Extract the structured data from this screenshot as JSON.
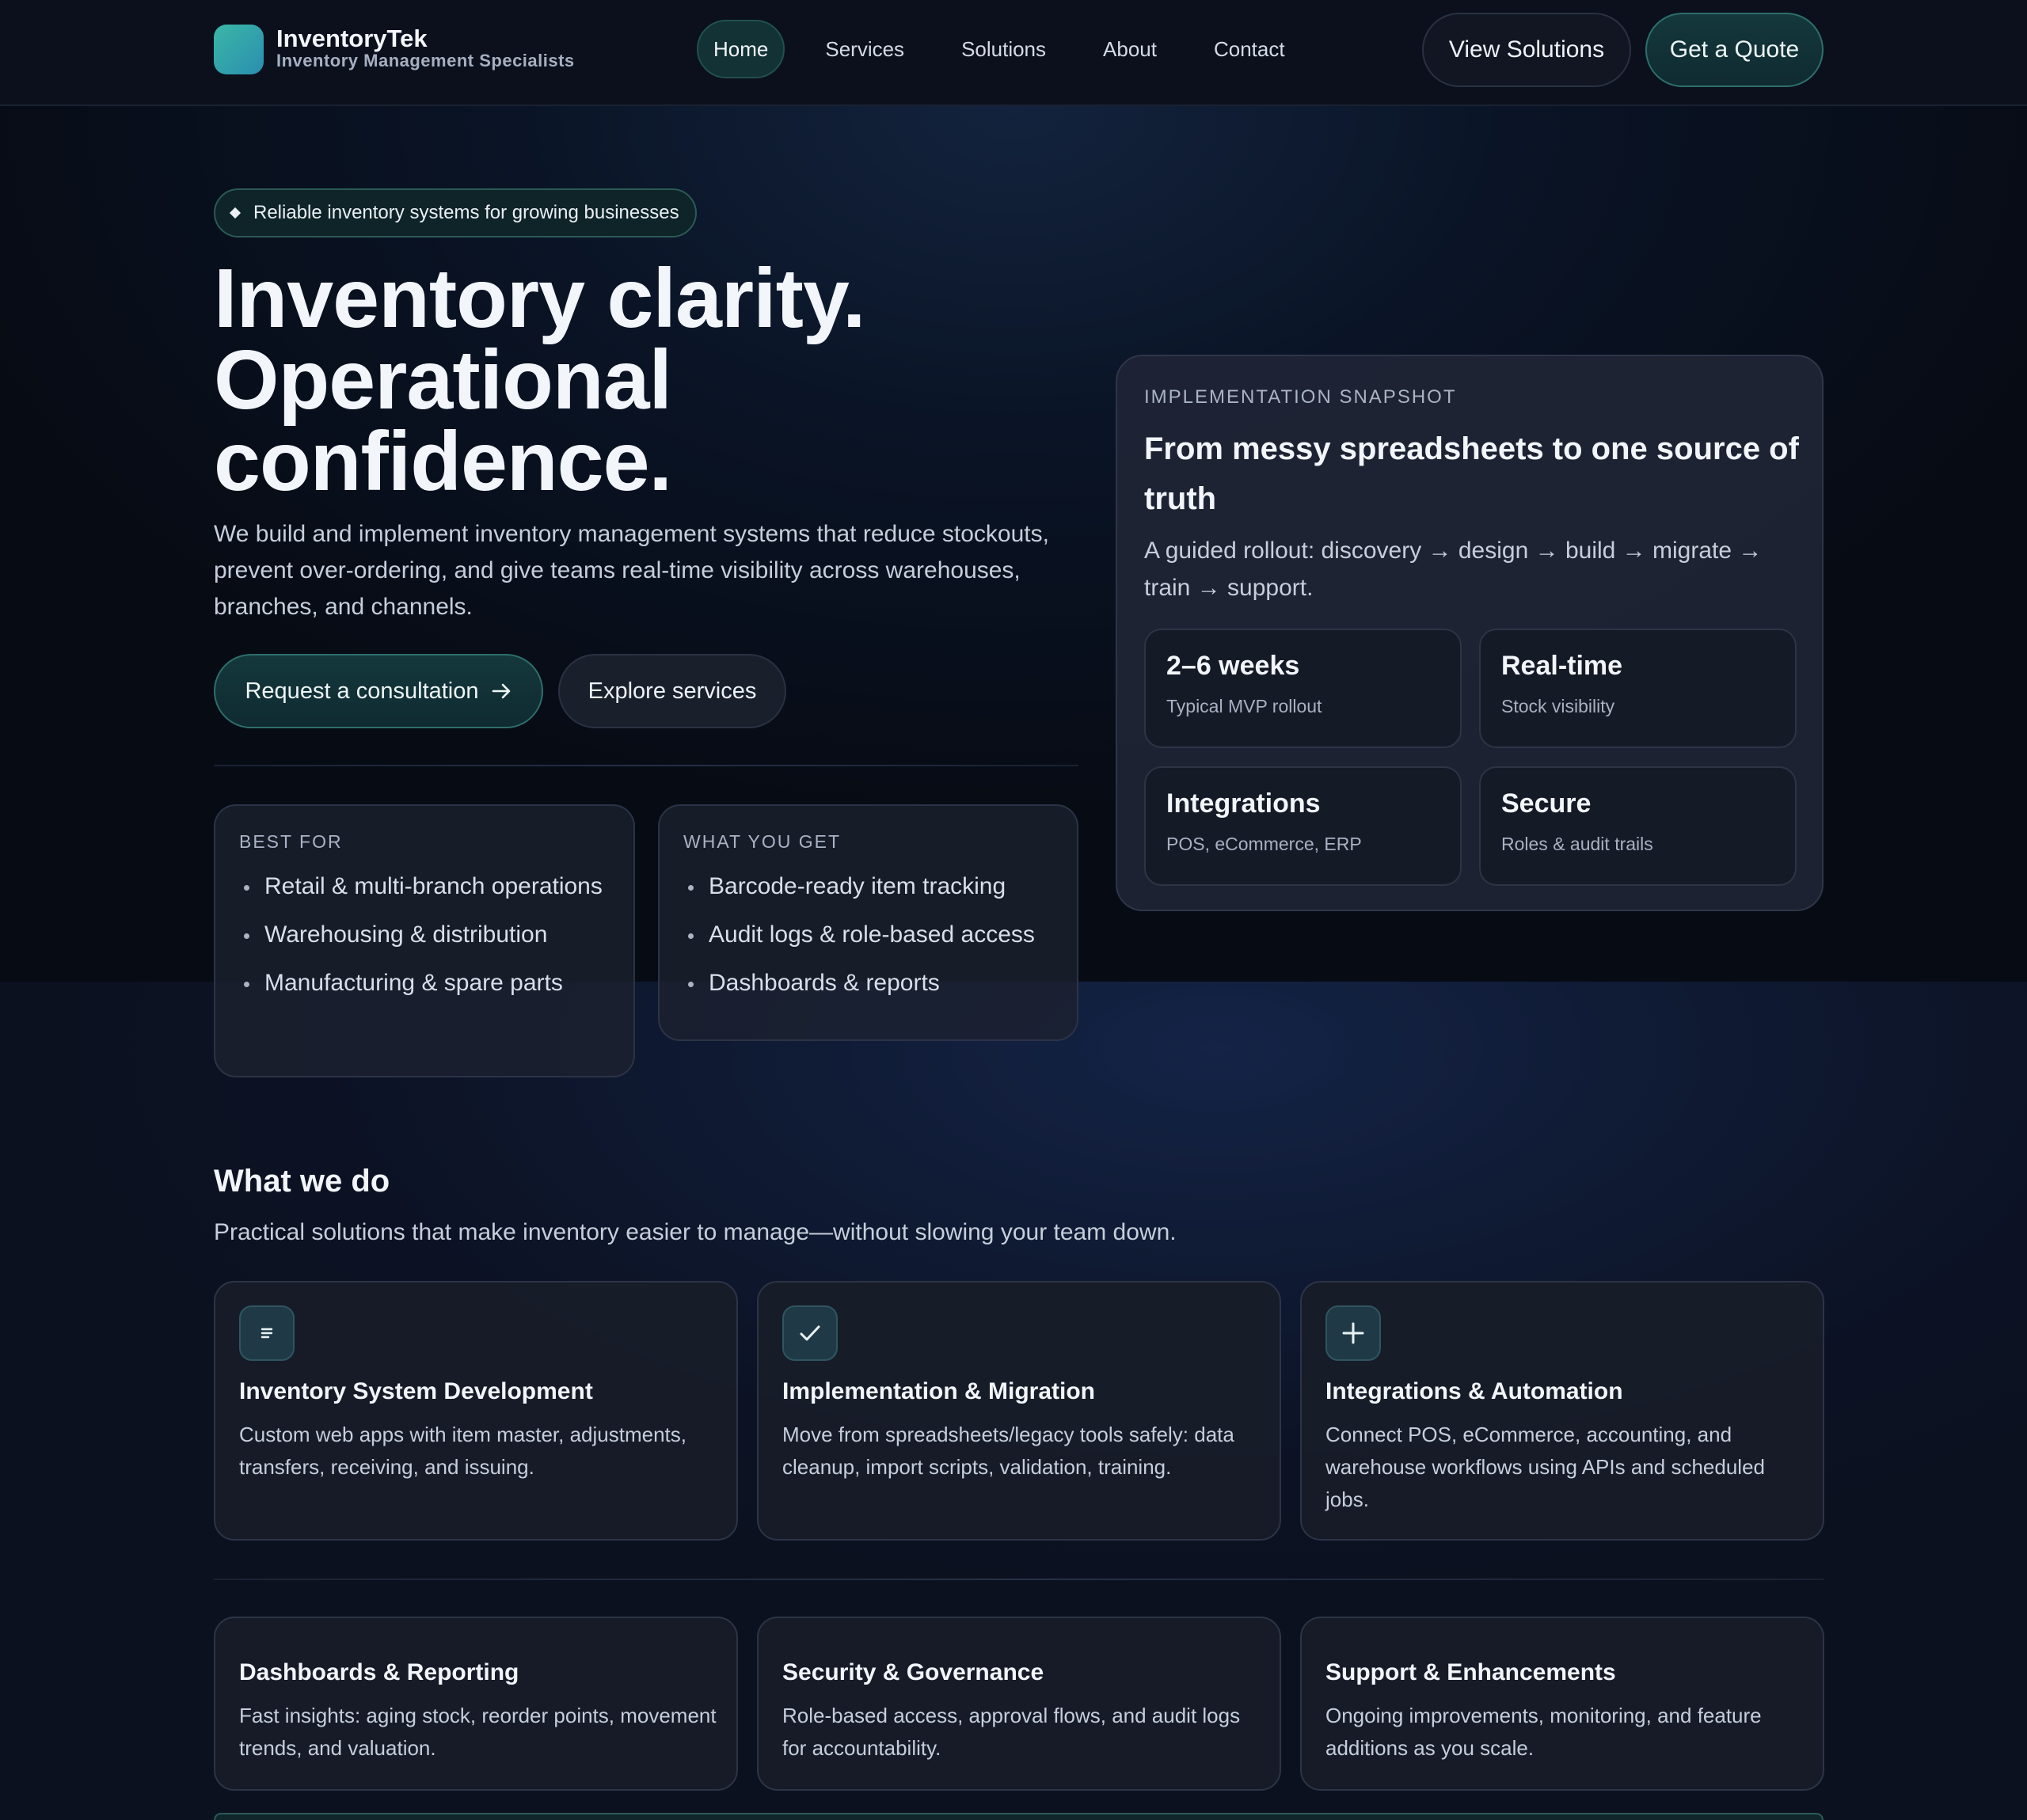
{
  "header": {
    "brand_name": "InventoryTek",
    "brand_tagline": "Inventory Management Specialists",
    "nav": [
      {
        "label": "Home",
        "active": true
      },
      {
        "label": "Services"
      },
      {
        "label": "Solutions"
      },
      {
        "label": "About"
      },
      {
        "label": "Contact"
      }
    ],
    "view_solutions_label": "View Solutions",
    "get_quote_label": "Get a Quote"
  },
  "hero": {
    "badge": "Reliable inventory systems for growing businesses",
    "title_lines": [
      "Inventory clarity.",
      "Operational",
      "confidence."
    ],
    "description": "We build and implement inventory management systems that reduce stockouts, prevent over-ordering, and give teams real-time visibility across warehouses, branches, and channels.",
    "primary_cta": "Request a consultation",
    "secondary_cta": "Explore services",
    "best_for": {
      "label": "BEST FOR",
      "items": [
        "Retail & multi-branch operations",
        "Warehousing & distribution",
        "Manufacturing & spare parts"
      ]
    },
    "what_you_get": {
      "label": "WHAT YOU GET",
      "items": [
        "Barcode-ready item tracking",
        "Audit logs & role-based access",
        "Dashboards & reports"
      ]
    }
  },
  "snapshot": {
    "label": "IMPLEMENTATION SNAPSHOT",
    "title": "From messy spreadsheets to one source of truth",
    "description": "A guided rollout: discovery → design → build → migrate → train → support.",
    "stats": [
      {
        "value": "2–6 weeks",
        "sub": "Typical MVP rollout"
      },
      {
        "value": "Real-time",
        "sub": "Stock visibility"
      },
      {
        "value": "Integrations",
        "sub": "POS, eCommerce, ERP"
      },
      {
        "value": "Secure",
        "sub": "Roles & audit trails"
      }
    ]
  },
  "services": {
    "title": "What we do",
    "subtitle": "Practical solutions that make inventory easier to manage—without slowing your team down.",
    "items": [
      {
        "icon": "list-icon",
        "title": "Inventory System Development",
        "desc": "Custom web apps with item master, adjustments, transfers, receiving, and issuing."
      },
      {
        "icon": "check-icon",
        "title": "Implementation & Migration",
        "desc": "Move from spreadsheets/legacy tools safely: data cleanup, import scripts, validation, training."
      },
      {
        "icon": "plus-icon",
        "title": "Integrations & Automation",
        "desc": "Connect POS, eCommerce, accounting, and warehouse workflows using APIs and scheduled jobs."
      },
      {
        "title": "Dashboards & Reporting",
        "desc": "Fast insights: aging stock, reorder points, movement trends, and valuation."
      },
      {
        "title": "Security & Governance",
        "desc": "Role-based access, approval flows, and audit logs for accountability."
      },
      {
        "title": "Support & Enhancements",
        "desc": "Ongoing improvements, monitoring, and feature additions as you scale."
      }
    ]
  },
  "colors": {
    "accent_teal": "#2d6f6c",
    "background": "#0b0f1a",
    "text": "#e8edf5"
  }
}
